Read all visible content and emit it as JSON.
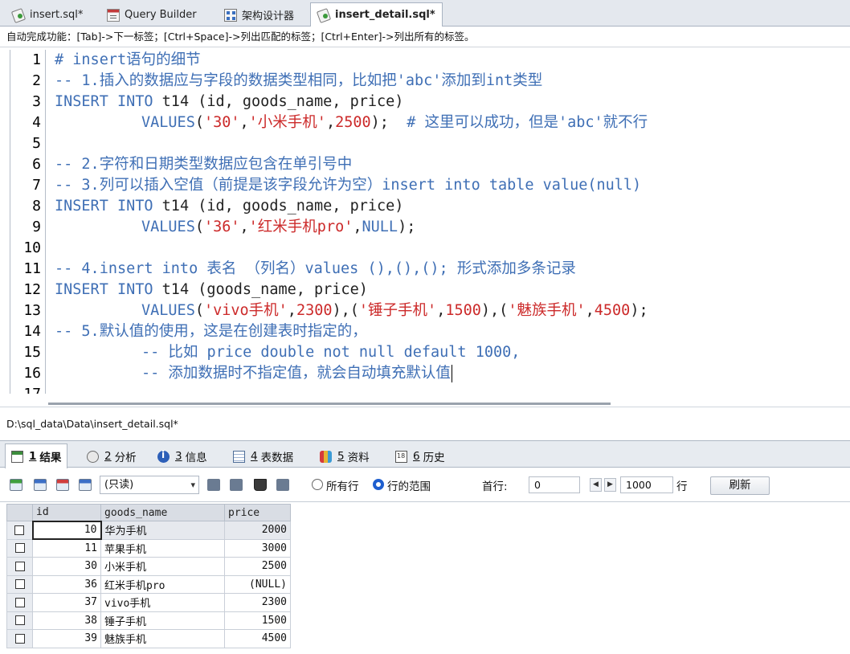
{
  "tabs": [
    {
      "label": "insert.sql*",
      "icon": "sql-file-icon",
      "active": false
    },
    {
      "label": "Query Builder",
      "icon": "query-builder-icon",
      "active": false
    },
    {
      "label": "架构设计器",
      "icon": "schema-designer-icon",
      "active": false
    },
    {
      "label": "insert_detail.sql*",
      "icon": "sql-file-icon",
      "active": true
    }
  ],
  "hint": "自动完成功能：[Tab]->下一标签；[Ctrl+Space]->列出匹配的标签；[Ctrl+Enter]->列出所有的标签。",
  "editor": {
    "line_numbers": [
      "1",
      "2",
      "3",
      "4",
      "5",
      "6",
      "7",
      "8",
      "9",
      "10",
      "11",
      "12",
      "13",
      "14",
      "15",
      "16",
      "17"
    ],
    "lines": {
      "l1": "# insert语句的细节",
      "l2": "-- 1.插入的数据应与字段的数据类型相同，比如把'abc'添加到int类型",
      "l3_kw": "INSERT INTO",
      "l3_rest": " t14 (id, goods_name, price)",
      "l4_kw": "VALUES",
      "l4_p1": "(",
      "l4_s1": "'30'",
      "l4_c1": ",",
      "l4_s2": "'小米手机'",
      "l4_c2": ",",
      "l4_n1": "2500",
      "l4_end": ");",
      "l4_cm": "  # 这里可以成功，但是'abc'就不行",
      "l6": "-- 2.字符和日期类型数据应包含在单引号中",
      "l7": "-- 3.列可以插入空值（前提是该字段允许为空）insert into table value(null)",
      "l8_kw": "INSERT INTO",
      "l8_rest": " t14 (id, goods_name, price)",
      "l9_kw": "VALUES",
      "l9_p1": "(",
      "l9_s1": "'36'",
      "l9_c1": ",",
      "l9_s2": "'红米手机pro'",
      "l9_c2": ",",
      "l9_kw2": "NULL",
      "l9_end": ");",
      "l11": "-- 4.insert into 表名 （列名）values (),(),(); 形式添加多条记录",
      "l12_kw": "INSERT INTO",
      "l12_rest": " t14 (goods_name, price)",
      "l13_kw": "VALUES",
      "l13_a": "(",
      "l13_s1": "'vivo手机'",
      "l13_b": ",",
      "l13_n1": "2300",
      "l13_c": "),(",
      "l13_s2": "'锤子手机'",
      "l13_d": ",",
      "l13_n2": "1500",
      "l13_e": "),(",
      "l13_s3": "'魅族手机'",
      "l13_f": ",",
      "l13_n3": "4500",
      "l13_g": ");",
      "l14": "-- 5.默认值的使用，这是在创建表时指定的，",
      "l15": "-- 比如 price double not null default 1000,",
      "l16": "-- 添加数据时不指定值，就会自动填充默认值"
    }
  },
  "file_path": "D:\\sql_data\\Data\\insert_detail.sql*",
  "result_tabs": [
    {
      "num": "1",
      "label": "结果",
      "icon": "result-icon",
      "active": true
    },
    {
      "num": "2",
      "label": "分析",
      "icon": "analysis-icon",
      "active": false
    },
    {
      "num": "3",
      "label": "信息",
      "icon": "info-icon",
      "active": false
    },
    {
      "num": "4",
      "label": "表数据",
      "icon": "table-data-icon",
      "active": false
    },
    {
      "num": "5",
      "label": "资料",
      "icon": "profile-icon",
      "active": false
    },
    {
      "num": "6",
      "label": "历史",
      "icon": "history-icon",
      "active": false
    }
  ],
  "toolbar": {
    "mode_select": "(只读)",
    "radio_all_rows": "所有行",
    "radio_row_range": "行的范围",
    "first_row_label": "首行:",
    "first_row_value": "0",
    "row_count_value": "1000",
    "rows_label": "行",
    "refresh_label": "刷新"
  },
  "grid": {
    "columns": [
      "id",
      "goods_name",
      "price"
    ],
    "rows": [
      {
        "id": "10",
        "goods_name": "华为手机",
        "price": "2000"
      },
      {
        "id": "11",
        "goods_name": "苹果手机",
        "price": "3000"
      },
      {
        "id": "30",
        "goods_name": "小米手机",
        "price": "2500"
      },
      {
        "id": "36",
        "goods_name": "红米手机pro",
        "price": "(NULL)"
      },
      {
        "id": "37",
        "goods_name": "vivo手机",
        "price": "2300"
      },
      {
        "id": "38",
        "goods_name": "锤子手机",
        "price": "1500"
      },
      {
        "id": "39",
        "goods_name": "魅族手机",
        "price": "4500"
      }
    ]
  },
  "colors": {
    "keyword": "#3f6fb5",
    "string": "#cc2a2a",
    "comment": "#3f6fb5",
    "radio_selected": "#1f5fcf"
  }
}
